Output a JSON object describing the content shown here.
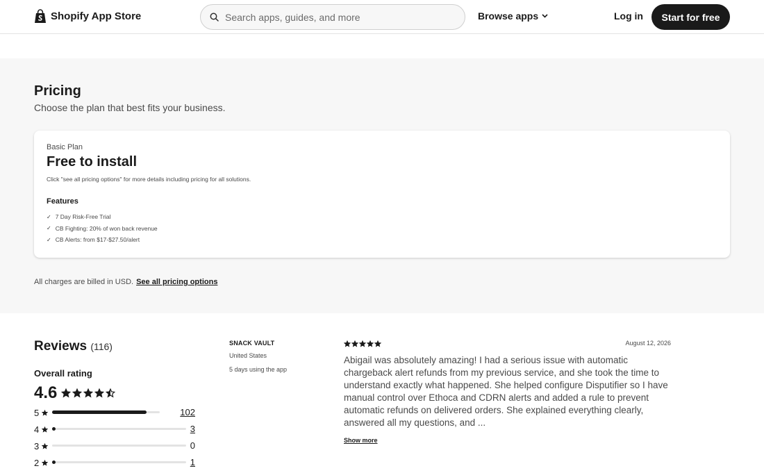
{
  "header": {
    "brand": "Shopify App Store",
    "search_placeholder": "Search apps, guides, and more",
    "browse_label": "Browse apps",
    "login_label": "Log in",
    "start_label": "Start for free"
  },
  "pricing": {
    "title": "Pricing",
    "subtitle": "Choose the plan that best fits your business.",
    "plan": {
      "name": "Basic Plan",
      "price": "Free to install",
      "note": "Click \"see all pricing options\" for more details including pricing for all solutions.",
      "features_title": "Features",
      "features": [
        "7 Day Risk-Free Trial",
        "CB Fighting: 20% of won back revenue",
        "CB Alerts: from $17-$27.50/alert"
      ]
    },
    "billing_text": "All charges are billed in USD.",
    "billing_link": "See all pricing options"
  },
  "reviews": {
    "title": "Reviews",
    "count": "(116)",
    "overall_label": "Overall rating",
    "overall_value": "4.6",
    "overall_stars": 4.6,
    "breakdown": [
      {
        "stars": "5",
        "count": "102",
        "fraction": 0.88
      },
      {
        "stars": "4",
        "count": "3",
        "fraction": 0.03
      },
      {
        "stars": "3",
        "count": "0",
        "fraction": 0
      },
      {
        "stars": "2",
        "count": "1",
        "fraction": 0.01
      }
    ],
    "review": {
      "reviewer_name": "SNACK VAULT",
      "reviewer_country": "United States",
      "reviewer_usage": "5 days using the app",
      "rating": 5,
      "date": "August 12, 2026",
      "body": "Abigail was absolutely amazing! I had a serious issue with automatic chargeback alert refunds from my previous service, and she took the time to understand exactly what happened. She helped configure Disputifier so I have manual control over Ethoca and CDRN alerts and added a rule to prevent automatic refunds on delivered orders. She explained everything clearly, answered all my questions, and ...",
      "show_more": "Show more"
    }
  }
}
